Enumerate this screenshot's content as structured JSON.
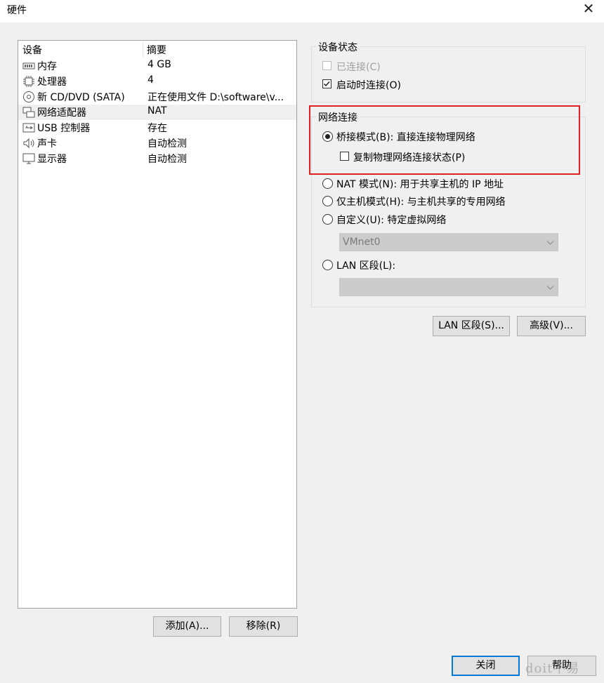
{
  "window": {
    "title": "硬件",
    "close_glyph": "✕"
  },
  "device_list": {
    "col_device": "设备",
    "col_summary": "摘要",
    "rows": [
      {
        "name": "内存",
        "summary": "4 GB",
        "icon": "memory-icon"
      },
      {
        "name": "处理器",
        "summary": "4",
        "icon": "cpu-icon"
      },
      {
        "name": "新 CD/DVD (SATA)",
        "summary": "正在使用文件 D:\\software\\v...",
        "icon": "cd-dvd-icon"
      },
      {
        "name": "网络适配器",
        "summary": "NAT",
        "icon": "network-adapter-icon",
        "selected": true
      },
      {
        "name": "USB 控制器",
        "summary": "存在",
        "icon": "usb-icon"
      },
      {
        "name": "声卡",
        "summary": "自动检测",
        "icon": "speaker-icon"
      },
      {
        "name": "显示器",
        "summary": "自动检测",
        "icon": "monitor-icon"
      }
    ]
  },
  "left_buttons": {
    "add": "添加(A)...",
    "remove": "移除(R)"
  },
  "device_status": {
    "label": "设备状态",
    "connected": {
      "label": "已连接(C)",
      "checked": false,
      "disabled": true
    },
    "connect_at_power_on": {
      "label": "启动时连接(O)",
      "checked": true
    }
  },
  "network_connection": {
    "label": "网络连接",
    "bridged": {
      "label": "桥接模式(B): 直接连接物理网络",
      "selected": true
    },
    "replicate": {
      "label": "复制物理网络连接状态(P)",
      "checked": false
    },
    "nat": {
      "label": "NAT 模式(N): 用于共享主机的 IP 地址",
      "selected": false
    },
    "host_only": {
      "label": "仅主机模式(H): 与主机共享的专用网络",
      "selected": false
    },
    "custom": {
      "label": "自定义(U): 特定虚拟网络",
      "selected": false,
      "value": "VMnet0"
    },
    "lan_segment": {
      "label": "LAN 区段(L):",
      "selected": false,
      "value": ""
    }
  },
  "right_buttons": {
    "lan_segments": "LAN 区段(S)...",
    "advanced": "高级(V)..."
  },
  "bottom_buttons": {
    "close": "关闭",
    "help": "帮助"
  },
  "watermark": "doit不易",
  "colors": {
    "highlight_box": "#e02020",
    "default_button_border": "#0078d7"
  }
}
